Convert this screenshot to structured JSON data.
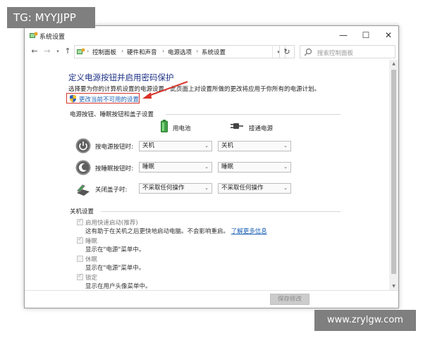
{
  "watermark": {
    "top": "TG: MYYJJPP",
    "bottom": "www.zrylgw.com"
  },
  "window": {
    "title": "系统设置",
    "icon": "system-settings-icon",
    "controls": {
      "minimize": "—",
      "maximize": "☐",
      "close": "✕"
    }
  },
  "nav": {
    "back": "←",
    "forward": "→",
    "recent": "▾",
    "up": "↑",
    "breadcrumbs": [
      "控制面板",
      "硬件和声音",
      "电源选项",
      "系统设置"
    ],
    "separator": "›",
    "address_dropdown": "▾",
    "refresh": "↻",
    "search_placeholder": "搜索控制面板"
  },
  "content": {
    "heading": "定义电源按钮并启用密码保护",
    "intro": "选择要为你的计算机设置的电源设置。此页面上对设置所做的更改将应用于你所有的电源计划。",
    "change_link": "更改当前不可用的设置",
    "power_section": {
      "title": "电源按钮、睡眠按钮和盖子设置",
      "battery_header": "用电池",
      "plugged_header": "接通电源",
      "rows": [
        {
          "label": "按电源按钮时:",
          "battery": "关机",
          "plugged": "关机",
          "icon": "power-button-icon"
        },
        {
          "label": "按睡眠按钮时:",
          "battery": "睡眠",
          "plugged": "睡眠",
          "icon": "sleep-button-icon"
        },
        {
          "label": "关闭盖子时:",
          "battery": "不采取任何操作",
          "plugged": "不采取任何操作",
          "icon": "laptop-lid-icon"
        }
      ]
    },
    "shutdown_section": {
      "title": "关机设置",
      "items": [
        {
          "label": "启用快速启动(推荐)",
          "checked": true,
          "desc": "这有助于在关机之后更快地启动电脑。不会影响重启。",
          "link": "了解更多信息"
        },
        {
          "label": "睡眠",
          "checked": true,
          "desc": "显示在\"电源\"菜单中。"
        },
        {
          "label": "休眠",
          "checked": false,
          "desc": "显示在\"电源\"菜单中。"
        },
        {
          "label": "锁定",
          "checked": true,
          "desc": "显示在用户头像菜单中。"
        }
      ]
    }
  },
  "footer": {
    "save_label": "保存修改"
  },
  "colors": {
    "heading": "#1e3287",
    "link": "#1a5fb4",
    "highlight_box": "#d9342b",
    "watermark_bg": "#7f7f7f"
  }
}
